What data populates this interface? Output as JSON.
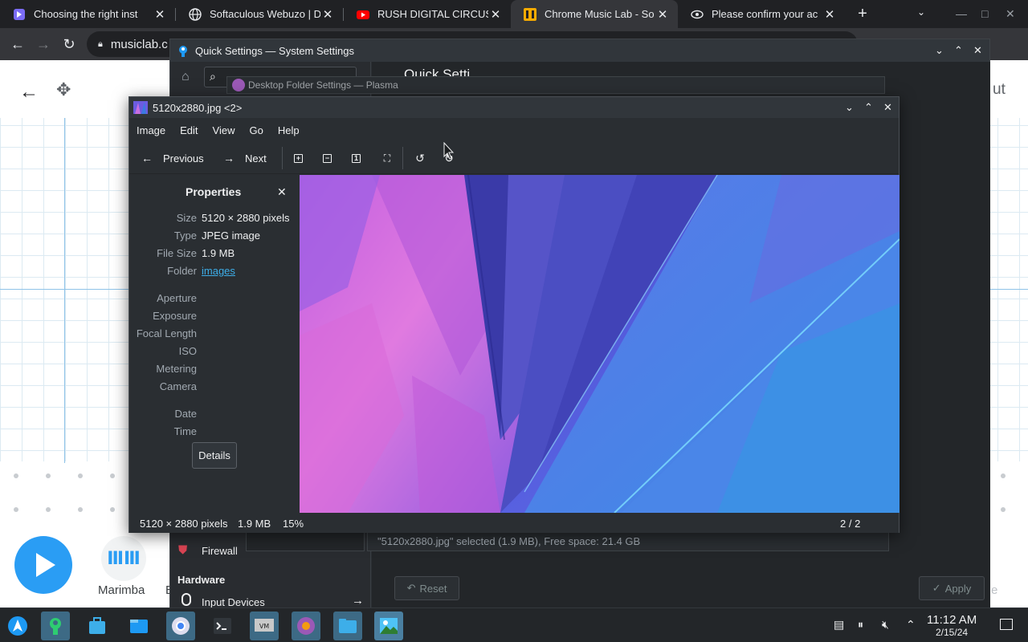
{
  "chrome": {
    "tabs": [
      {
        "title": "Choosing the right inst",
        "icon": "doc-favicon-icon"
      },
      {
        "title": "Softaculous Webuzo | D",
        "icon": "globe-favicon-icon"
      },
      {
        "title": "RUSH DIGITAL CIRCUS",
        "icon": "youtube-favicon-icon"
      },
      {
        "title": "Chrome Music Lab - So",
        "icon": "musiclab-favicon-icon"
      },
      {
        "title": "Please confirm your ac",
        "icon": "eye-favicon-icon"
      }
    ],
    "new_tab": "+",
    "address": "musiclab.c",
    "tab_search": "⌄",
    "controls": {
      "minimize": "—",
      "maximize": "□",
      "close": "✕"
    }
  },
  "musiclab": {
    "instrument_label": "Marimba",
    "next_instrument_letter": "E",
    "header_right_text": "ut",
    "reset_label": "Reset",
    "apply_label": "Apply",
    "apply_right_letter": "e"
  },
  "system_settings": {
    "title": "Quick Settings — System Settings",
    "page_title": "Quick Setti",
    "sidebar": {
      "firewall_label": "Firewall",
      "hardware_header": "Hardware",
      "input_devices_label": "Input Devices"
    },
    "status_text": "\"5120x2880.jpg\" selected (1.9 MB), Free space: 21.4 GB",
    "reset_label": "Reset",
    "apply_label": "Apply"
  },
  "desktop_folder": {
    "title": "Desktop Folder Settings — Plasma"
  },
  "gwenview": {
    "title": "5120x2880.jpg <2>",
    "menu": [
      "Image",
      "Edit",
      "View",
      "Go",
      "Help"
    ],
    "toolbar": {
      "previous_label": "Previous",
      "next_label": "Next"
    },
    "properties": {
      "title": "Properties",
      "rows": [
        {
          "key": "Size",
          "value": "5120 × 2880 pixels"
        },
        {
          "key": "Type",
          "value": "JPEG image"
        },
        {
          "key": "File Size",
          "value": "1.9 MB"
        },
        {
          "key": "Folder",
          "value": "images"
        },
        {
          "key": "Aperture",
          "value": ""
        },
        {
          "key": "Exposure",
          "value": ""
        },
        {
          "key": "Focal Length",
          "value": ""
        },
        {
          "key": "ISO",
          "value": ""
        },
        {
          "key": "Metering",
          "value": ""
        },
        {
          "key": "Camera",
          "value": ""
        },
        {
          "key": "Date",
          "value": ""
        },
        {
          "key": "Time",
          "value": ""
        }
      ],
      "details_button": "Details"
    },
    "status": {
      "dims": "5120 × 2880 pixels",
      "size": "1.9 MB",
      "zoom": "15%",
      "position": "2 / 2"
    }
  },
  "taskbar": {
    "time": "11:12 AM",
    "date": "2/15/24"
  },
  "colors": {
    "kde_dark": "#2a2e32",
    "kde_text": "#eff0f1",
    "kde_link": "#3daee9",
    "chrome_dark": "#202124",
    "musiclab_blue": "#2a9df4"
  }
}
